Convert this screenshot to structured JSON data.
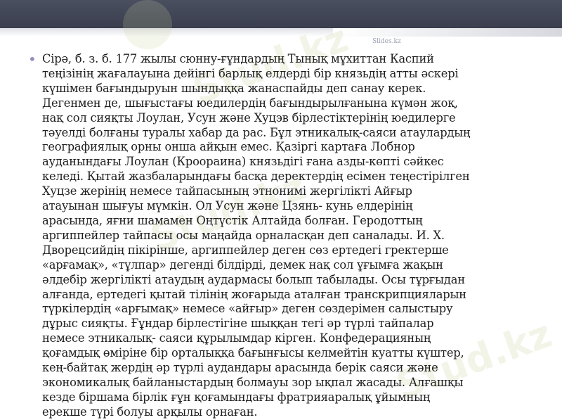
{
  "slide": {
    "source_label": "Slides.kz",
    "watermark_text": "Stud.kz",
    "bullet_glyph": "•",
    "lines": [
      "Сірә, б. з. б. 177 жылы сюнну-ғұндардың Тынық мұхиттан Каспий",
      "теңізінің жағалауына дейінгі барлық елдерді бір князьдің атты әскері",
      "күшімен бағындыруын шындыққа жанаспайды деп санау керек.",
      "Дегенмен де, шығыстағы юедилердің бағындырылғанына күмән жоқ,",
      "нақ сол сияқты Лоулан, Усун және Хуцэв бірлестіктерінің юедилерге",
      "тәуелді болғаны туралы хабар да рас. Бұл этникалық-саяси атаулардың",
      "географиялық орны онша айқын емес. Қазіргі картаға Лобнор",
      "ауданындағы Лоулан (Кроораина) князьдігі ғана азды-көпті сәйкес",
      "келеді. Қытай жазбаларындағы басқа деректердің есімен теңестірілген",
      "Хуцзе жерінің немесе тайпасының этнонимі жергілікті Айғыр",
      "атауынан шығуы мүмкін. Ол Усун және Цзянь- кунь елдерінің",
      "арасында, яғни шамамен Оңтүстік Алтайда болған. Геродоттың",
      "аргиппейлер тайпасы осы маңайда орналасқан деп саналады. И. Х.",
      "Дворецсийдің пікірінше, аргиппейлер деген сөз ертедегі гректерше",
      "«арғамақ», «тұлпар» дегенді білдірді, демек нақ сол ұғымға жақын",
      "әлдебір жергілікті атаудың аудармасы болып табылады. Осы тұрғыдан",
      "алғанда, ертедегі қытай тілінің жоғарыда аталған транскрипцияларын",
      "түркілердің «арғымақ» немесе «айғыр» деген сөздерімен салыстыру",
      "дұрыс сияқты. Ғұндар бірлестігіне шыққан тегі әр түрлі тайпалар",
      "немесе этникалық- саяси құрылымдар кірген. Конфедерацияның",
      "қоғамдық өміріне бір орталыққа бағынғысы келмейтін куатты күштер,",
      "кең-байтақ жердің әр түрлі аудандары арасында берік саяси және",
      "экономикалық байланыстардың болмауы зор ықпал жасады. Алғашқы",
      "кезде біршама бірлік ғұн қоғамындағы фратрияаралық ұйымның",
      "ерекше түрі болуы арқылы орнаған."
    ]
  },
  "colors": {
    "header_band": "#3a3e4d",
    "bullet": "#8f8fbf",
    "text": "#1e1e1e"
  }
}
